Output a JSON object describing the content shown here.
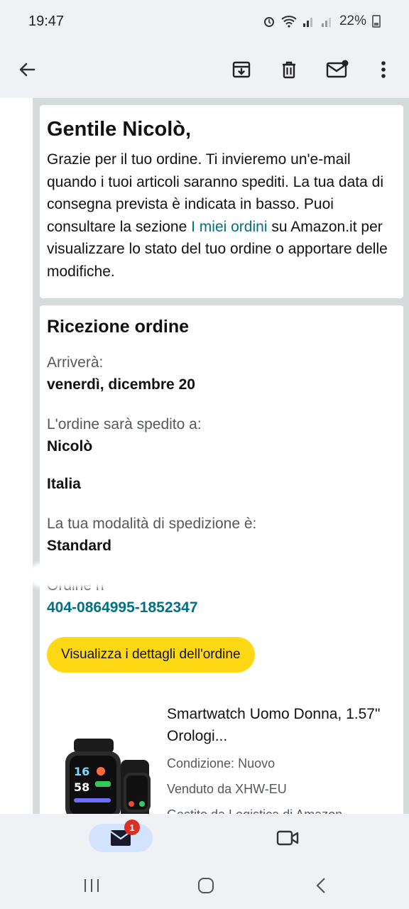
{
  "status": {
    "time": "19:47",
    "battery": "22%"
  },
  "toolbar": {
    "icons": [
      "back-arrow-icon",
      "archive-icon",
      "delete-icon",
      "mark-unread-icon",
      "more-vert-icon"
    ]
  },
  "email": {
    "greeting": "Gentile Nicolò,",
    "intro_before_link": "Grazie per il tuo ordine. Ti invieremo un'e-mail quando i tuoi articoli saranno spediti. La tua data di consegna prevista è indicata in basso. Puoi consultare la sezione ",
    "intro_link": "I miei ordini",
    "intro_after_link": " su Amazon.it per visualizzare lo stato del tuo ordine o apportare delle modifiche.",
    "section_title": "Ricezione ordine",
    "arrival_label": "Arriverà:",
    "arrival_value": "venerdì, dicembre 20",
    "ship_to_label": "L'ordine sarà spedito a:",
    "ship_name": "Nicolò",
    "ship_country": "Italia",
    "shipping_method_label": "La tua modalità di spedizione è:",
    "shipping_method_value": "Standard",
    "order_label": "Ordine n°",
    "order_number": "404-0864995-1852347",
    "details_button": "Visualizza i dettagli dell'ordine",
    "product": {
      "title": "Smartwatch Uomo Donna, 1.57\" Orologi...",
      "condition": "Condizione: Nuovo",
      "seller": "Venduto da XHW-EU",
      "fulfilled": "Gestito da Logistica di Amazon"
    }
  },
  "bottom_nav": {
    "mail_badge": "1"
  },
  "colors": {
    "accent_link": "#007185",
    "button_yellow": "#ffd814",
    "badge_red": "#d93025"
  }
}
